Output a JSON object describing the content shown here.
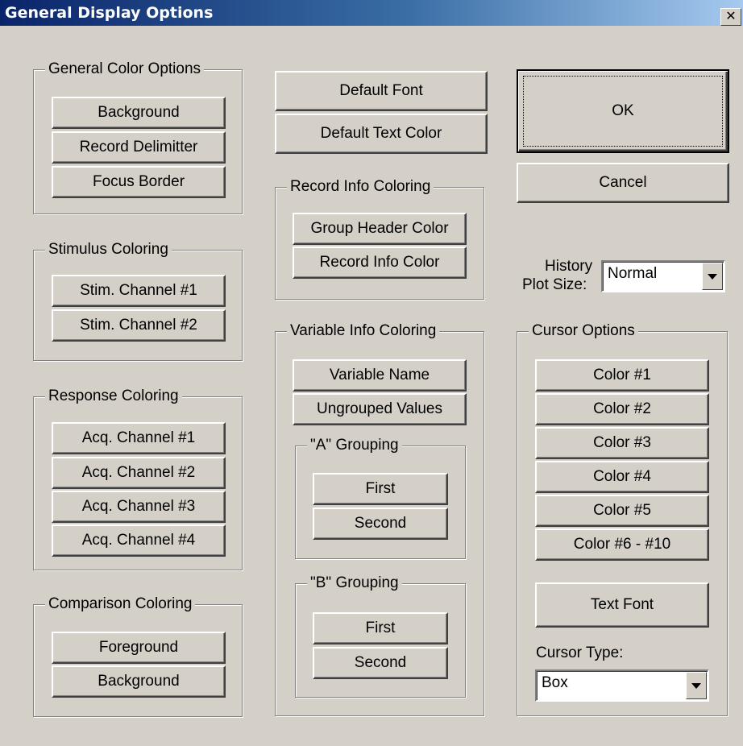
{
  "window": {
    "title": "General Display Options",
    "close_glyph": "✕"
  },
  "general_color": {
    "label": "General Color Options",
    "buttons": [
      "Background",
      "Record Delimitter",
      "Focus Border"
    ]
  },
  "stimulus": {
    "label": "Stimulus Coloring",
    "buttons": [
      "Stim. Channel #1",
      "Stim. Channel #2"
    ]
  },
  "response": {
    "label": "Response Coloring",
    "buttons": [
      "Acq. Channel #1",
      "Acq. Channel #2",
      "Acq. Channel #3",
      "Acq. Channel #4"
    ]
  },
  "comparison": {
    "label": "Comparison Coloring",
    "buttons": [
      "Foreground",
      "Background"
    ]
  },
  "center": {
    "default_font": "Default Font",
    "default_text_color": "Default Text Color"
  },
  "record_info": {
    "label": "Record Info Coloring",
    "buttons": [
      "Group Header Color",
      "Record Info Color"
    ]
  },
  "variable_info": {
    "label": "Variable Info Coloring",
    "buttons": [
      "Variable Name",
      "Ungrouped Values"
    ],
    "a_grouping": {
      "label": "\"A\" Grouping",
      "buttons": [
        "First",
        "Second"
      ]
    },
    "b_grouping": {
      "label": "\"B\" Grouping",
      "buttons": [
        "First",
        "Second"
      ]
    }
  },
  "actions": {
    "ok": "OK",
    "cancel": "Cancel"
  },
  "history": {
    "label_line1": "History",
    "label_line2": "Plot Size:",
    "value": "Normal"
  },
  "cursor": {
    "label": "Cursor Options",
    "buttons": [
      "Color #1",
      "Color #2",
      "Color #3",
      "Color #4",
      "Color #5",
      "Color #6 - #10"
    ],
    "text_font": "Text Font",
    "type_label": "Cursor Type:",
    "type_value": "Box"
  },
  "icons": {
    "dropdown": "chevron-down-icon",
    "close": "close-icon"
  },
  "colors": {
    "face": "#d4d0c8",
    "title_start": "#0a246a",
    "title_end": "#a6caf0"
  }
}
